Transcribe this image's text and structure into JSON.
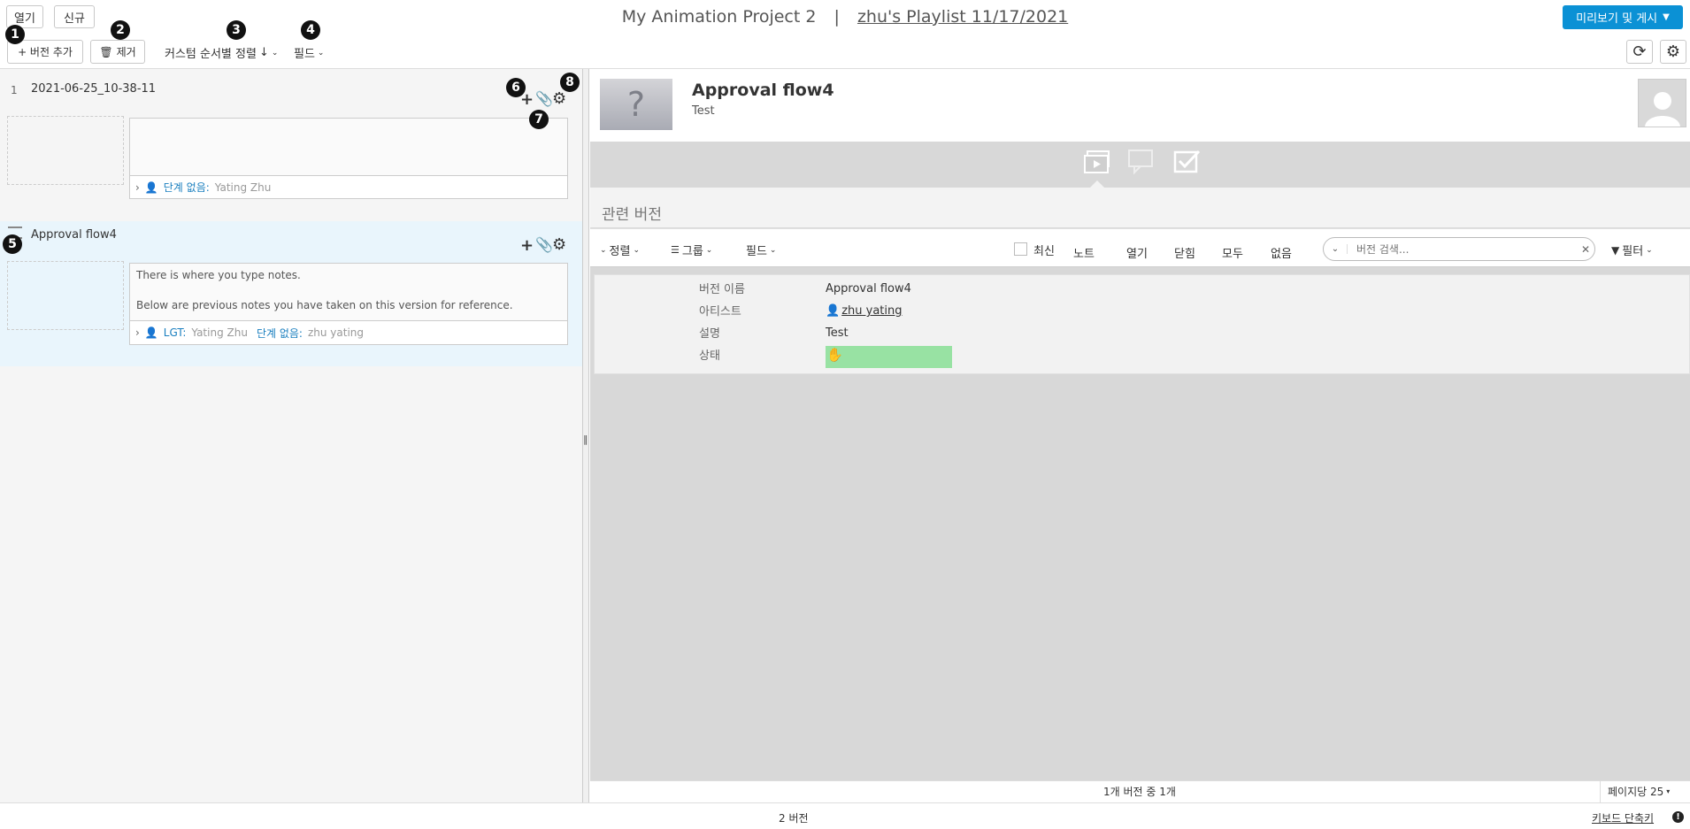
{
  "header": {
    "open_label": "열기",
    "new_label": "신규",
    "project": "My Animation Project 2",
    "separator": "|",
    "playlist": "zhu's Playlist 11/17/2021",
    "publish_label": "미리보기 및 게시"
  },
  "toolbar": {
    "add_version_label": "+ 버전 추가",
    "remove_label": "제거",
    "sort_label": "커스텀 순서별 정렬",
    "fields_label": "필드"
  },
  "callouts": [
    "1",
    "2",
    "3",
    "4",
    "5",
    "6",
    "7",
    "8"
  ],
  "versions": [
    {
      "index": "1",
      "name": "2021-06-25_10-38-11",
      "notes": "",
      "footer_status": "단계 없음:",
      "footer_user": "Yating Zhu"
    },
    {
      "name": "Approval flow4",
      "notes_line1": "There is where you type notes.",
      "notes_line2": "Below are previous notes you have taken on this version for reference.",
      "footer_label1": "LGT:",
      "footer_user1": "Yating Zhu",
      "footer_status2": "단계 없음:",
      "footer_user2": "zhu yating"
    }
  ],
  "detail": {
    "title": "Approval flow4",
    "subtitle": "Test",
    "section_title": "관련 버전",
    "toolbar": {
      "sort": "정렬",
      "group": "그룹",
      "fields": "필드",
      "latest": "최신",
      "notes": "노트",
      "open": "열기",
      "closed": "닫힘",
      "all": "모두",
      "none": "없음",
      "search_placeholder": "버전 검색...",
      "filter": "필터"
    },
    "row": {
      "name_label": "버전 이름",
      "name_value": "Approval flow4",
      "artist_label": "아티스트",
      "artist_value": "zhu yating",
      "desc_label": "설명",
      "desc_value": "Test",
      "status_label": "상태",
      "status_color": "#98e2a3"
    },
    "pagination": "1개 버전 중 1개",
    "per_page": "페이지당 25"
  },
  "footer": {
    "count": "2 버전",
    "shortcuts": "키보드 단축키"
  },
  "colors": {
    "accent": "#0b91d5",
    "link_blue": "#1a7fbf",
    "panel_bg": "#f5f5f5",
    "selected_row": "#e9f5fc"
  }
}
